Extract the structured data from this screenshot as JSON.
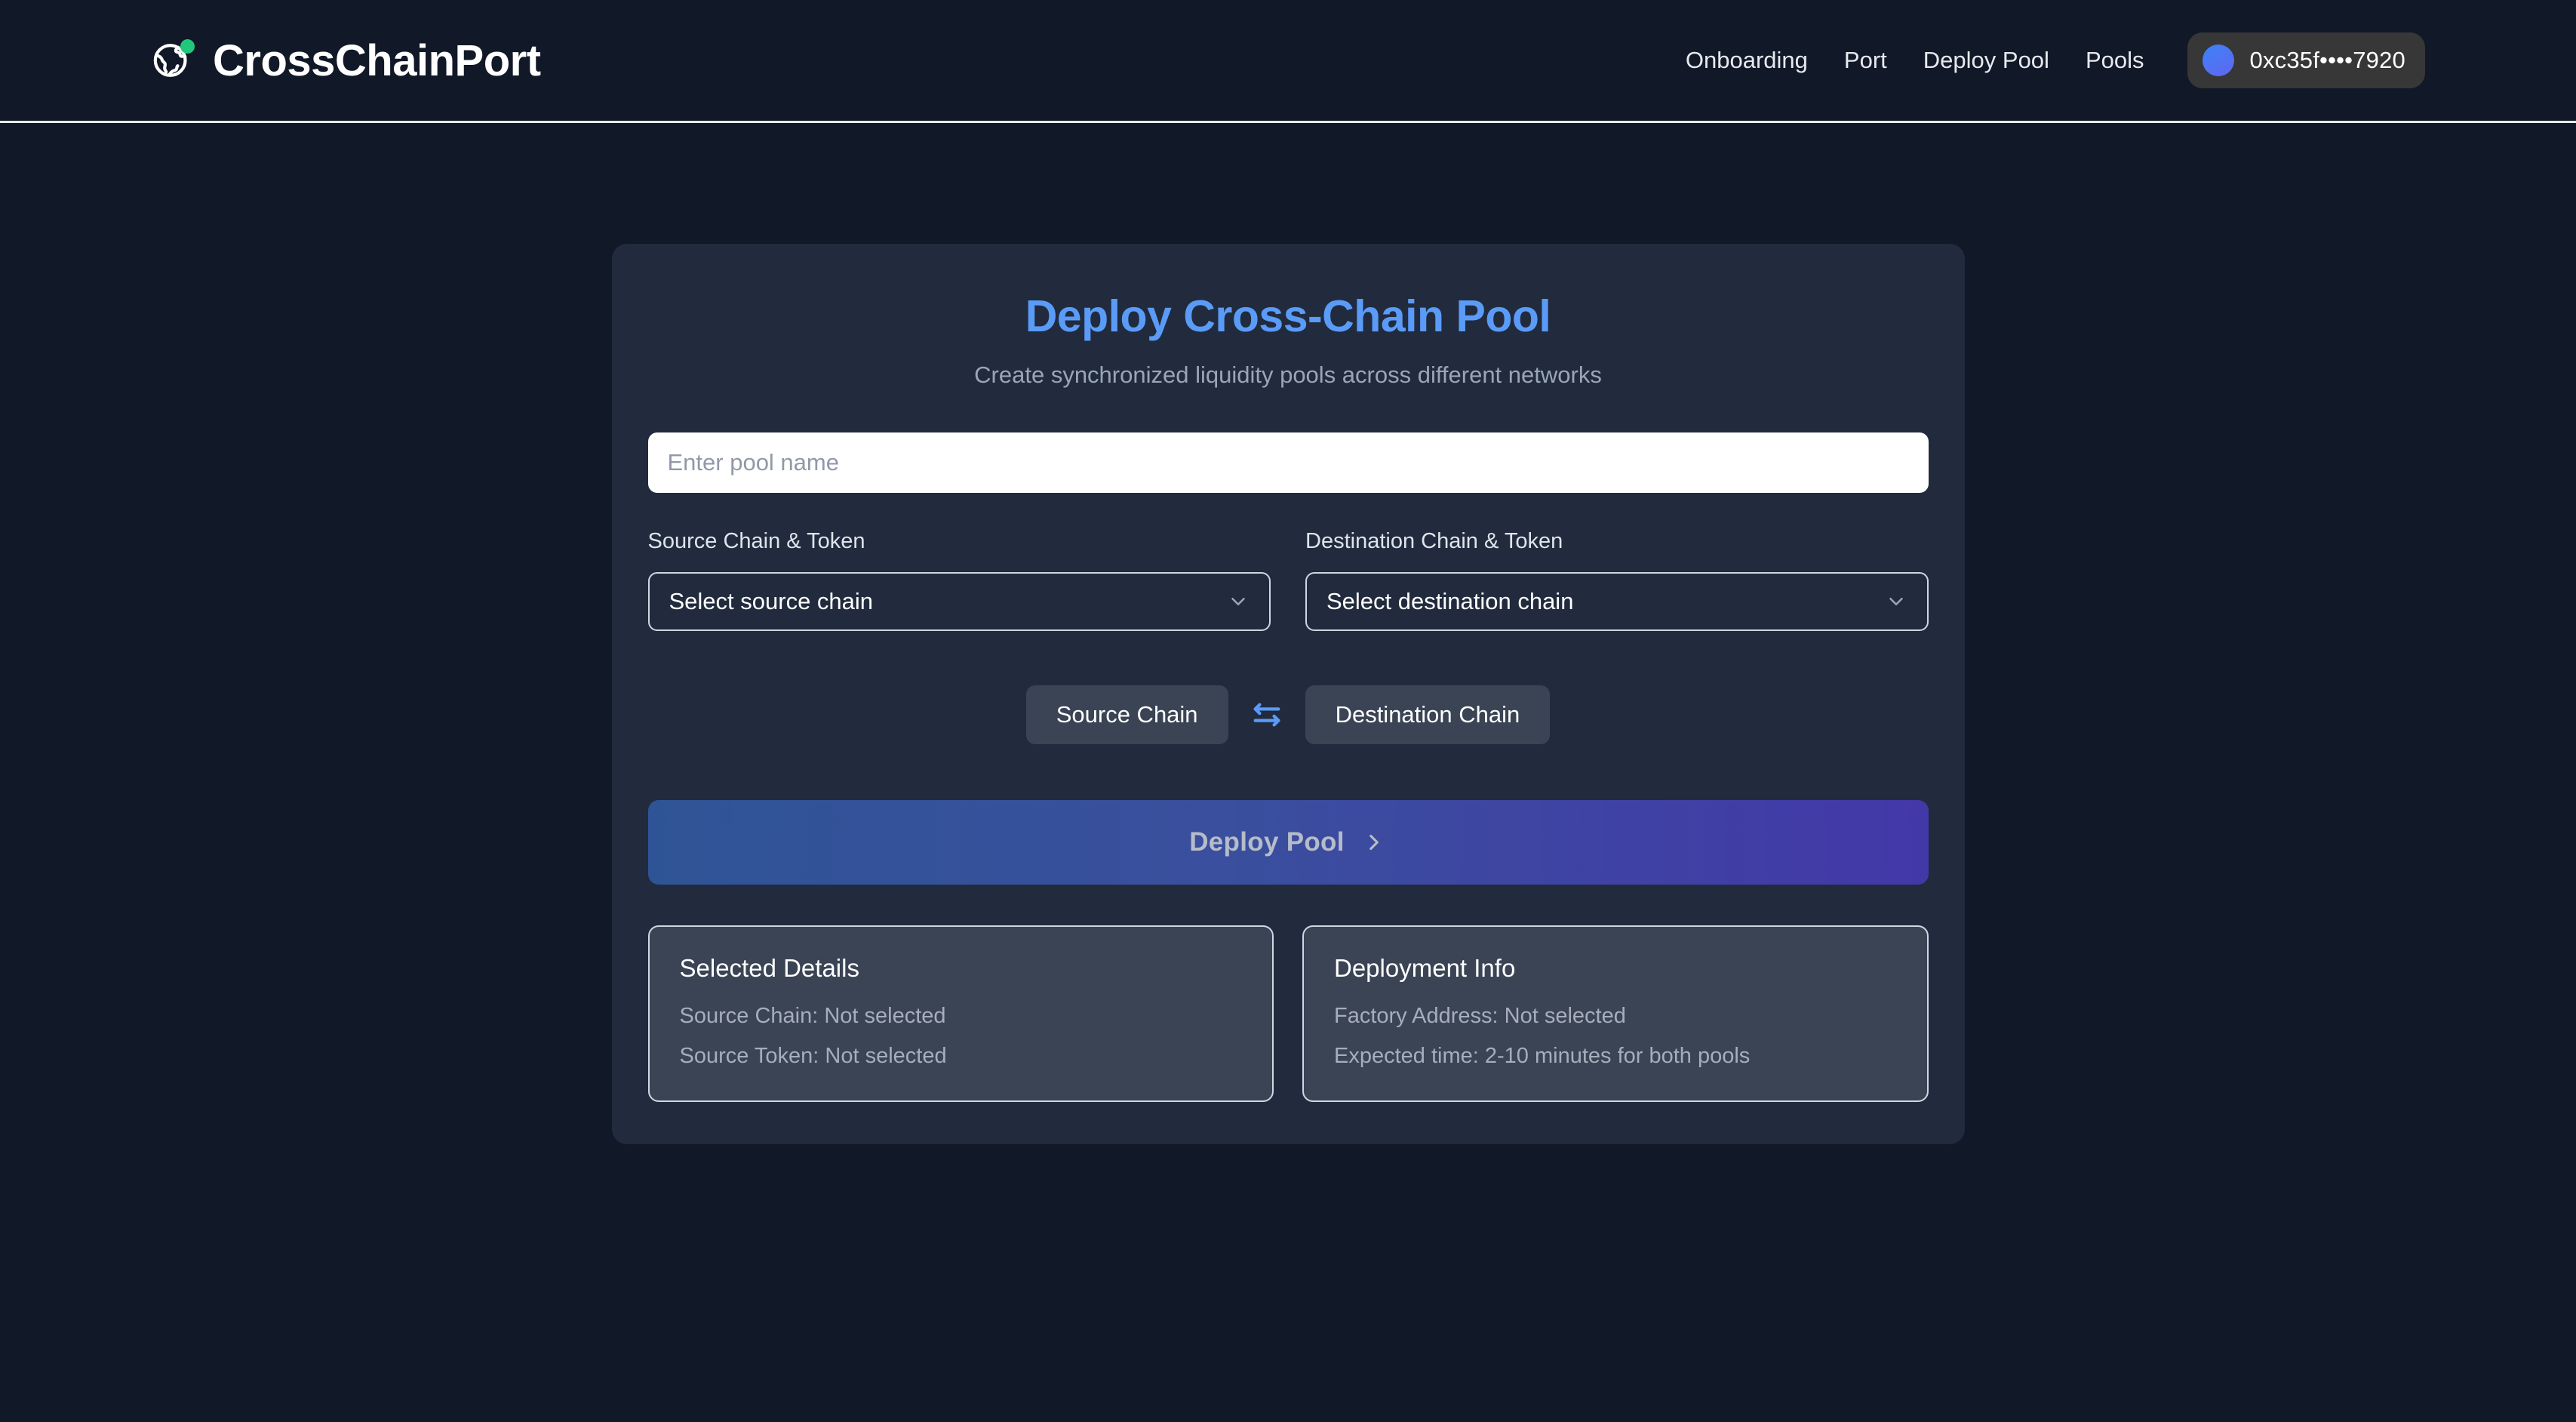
{
  "header": {
    "brand_name": "CrossChainPort",
    "logo_icon": "globe-icon",
    "status_dot_color": "#22c77e",
    "nav_items": [
      {
        "label": "Onboarding"
      },
      {
        "label": "Port"
      },
      {
        "label": "Deploy Pool"
      },
      {
        "label": "Pools"
      }
    ],
    "wallet": {
      "address": "0xc35f••••7920",
      "avatar_gradient_from": "#3b82f6",
      "avatar_gradient_to": "#6366f1"
    }
  },
  "main": {
    "title": "Deploy Cross-Chain Pool",
    "title_color": "#5b9bf8",
    "subtitle": "Create synchronized liquidity pools across different networks",
    "pool_name": {
      "value": "",
      "placeholder": "Enter pool name"
    },
    "source": {
      "label": "Source Chain & Token",
      "select_value": "Select source chain",
      "chevron_icon": "chevron-down-icon"
    },
    "destination": {
      "label": "Destination Chain & Token",
      "select_value": "Select destination chain",
      "chevron_icon": "chevron-down-icon"
    },
    "swap": {
      "source_button": "Source Chain",
      "swap_icon": "swap-horizontal-icon",
      "swap_icon_color": "#5b9bf8",
      "destination_button": "Destination Chain"
    },
    "deploy": {
      "label": "Deploy Pool",
      "icon": "chevron-right-icon",
      "gradient_from": "#2f5496",
      "gradient_to": "#4338a8",
      "disabled": true
    },
    "info_cards": [
      {
        "title": "Selected Details",
        "lines": [
          "Source Chain: Not selected",
          "Source Token: Not selected"
        ]
      },
      {
        "title": "Deployment Info",
        "lines": [
          "Factory Address: Not selected",
          "Expected time: 2-10 minutes for both pools"
        ]
      }
    ]
  }
}
